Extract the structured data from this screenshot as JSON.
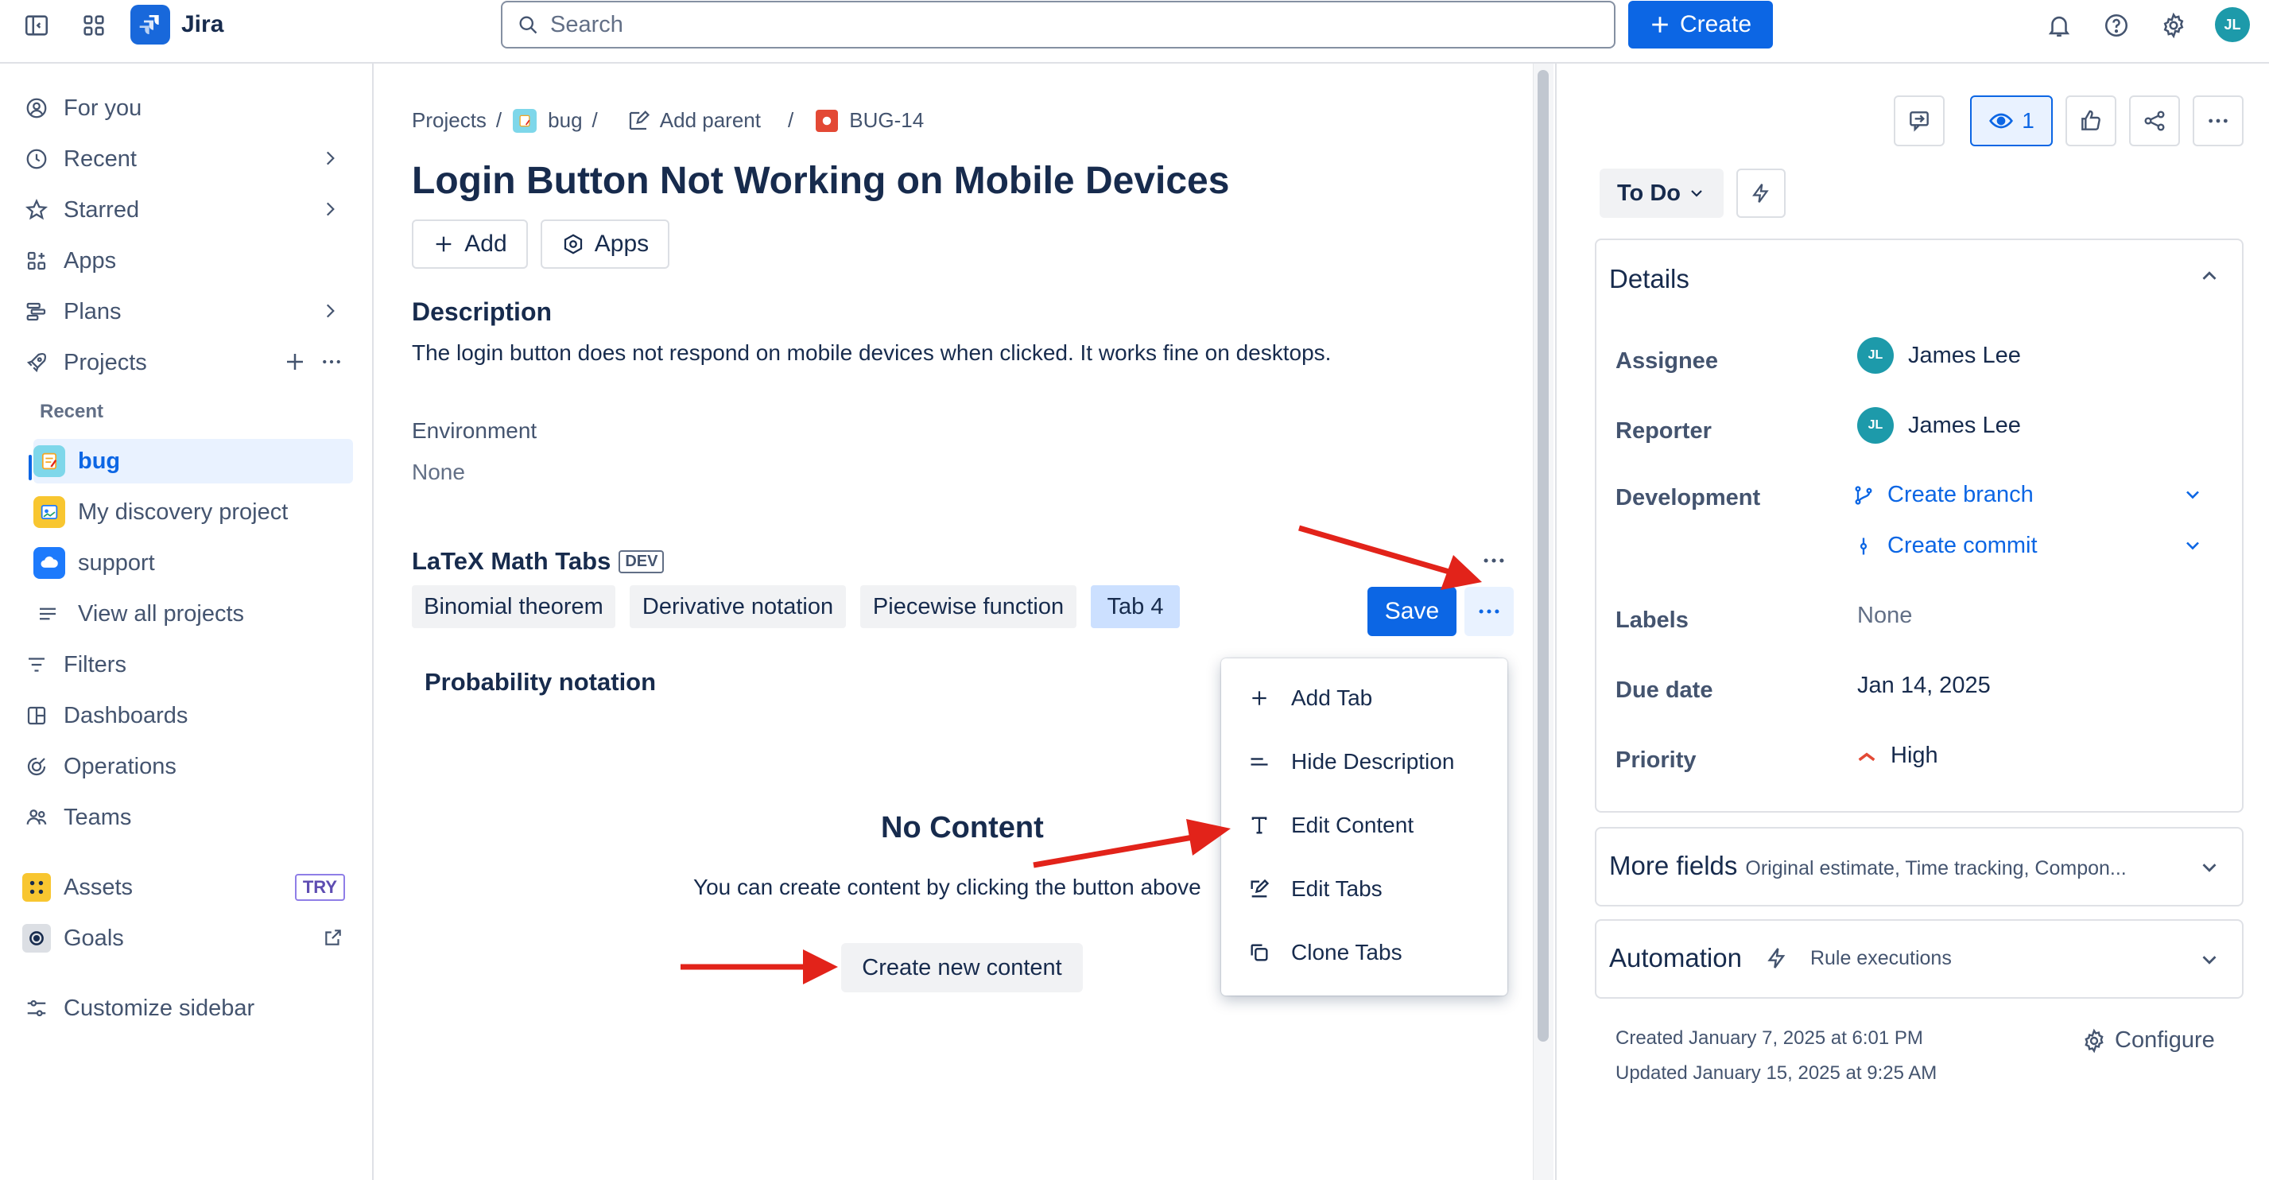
{
  "app": {
    "name": "Jira"
  },
  "topbar": {
    "search_placeholder": "Search",
    "create_label": "Create",
    "user_initials": "JL"
  },
  "sidebar": {
    "for_you": "For you",
    "recent": "Recent",
    "starred": "Starred",
    "apps": "Apps",
    "plans": "Plans",
    "projects": "Projects",
    "recent_header": "Recent",
    "project_items": [
      "bug",
      "My discovery project",
      "support"
    ],
    "view_all": "View all projects",
    "filters": "Filters",
    "dashboards": "Dashboards",
    "operations": "Operations",
    "teams": "Teams",
    "assets": "Assets",
    "assets_badge": "TRY",
    "goals": "Goals",
    "customize": "Customize sidebar"
  },
  "breadcrumb": {
    "projects": "Projects",
    "project": "bug",
    "add_parent": "Add parent",
    "issue_key": "BUG-14",
    "sep": "/"
  },
  "issue": {
    "title": "Login Button Not Working on Mobile Devices",
    "add_label": "Add",
    "apps_label": "Apps",
    "description_heading": "Description",
    "description_text": "The login button does not respond on mobile devices when clicked. It works fine on desktops.",
    "environment_heading": "Environment",
    "environment_value": "None"
  },
  "latex": {
    "heading": "LaTeX Math Tabs",
    "badge": "DEV",
    "tabs": [
      "Binomial theorem",
      "Derivative notation",
      "Piecewise function",
      "Tab 4"
    ],
    "save_label": "Save",
    "tab_content_title": "Probability notation",
    "empty_title": "No Content",
    "empty_text": "You can create content by clicking the button above",
    "create_content_label": "Create new content"
  },
  "menu": {
    "items": [
      "Add Tab",
      "Hide Description",
      "Edit Content",
      "Edit Tabs",
      "Clone Tabs"
    ]
  },
  "right": {
    "watch_count": "1",
    "status": "To Do",
    "details_heading": "Details",
    "assignee_label": "Assignee",
    "assignee_value": "James Lee",
    "reporter_label": "Reporter",
    "reporter_value": "James Lee",
    "initials": "JL",
    "development_label": "Development",
    "create_branch": "Create branch",
    "create_commit": "Create commit",
    "labels_label": "Labels",
    "labels_value": "None",
    "due_label": "Due date",
    "due_value": "Jan 14, 2025",
    "priority_label": "Priority",
    "priority_value": "High",
    "more_fields": "More fields",
    "more_fields_sub": "Original estimate, Time tracking, Compon...",
    "automation": "Automation",
    "rule_executions": "Rule executions",
    "created": "Created January 7, 2025 at 6:01 PM",
    "updated": "Updated January 15, 2025 at 9:25 AM",
    "configure": "Configure"
  },
  "colors": {
    "accent": "#0c66e4",
    "arrow": "#e2231a",
    "priority_high": "#e34935"
  }
}
